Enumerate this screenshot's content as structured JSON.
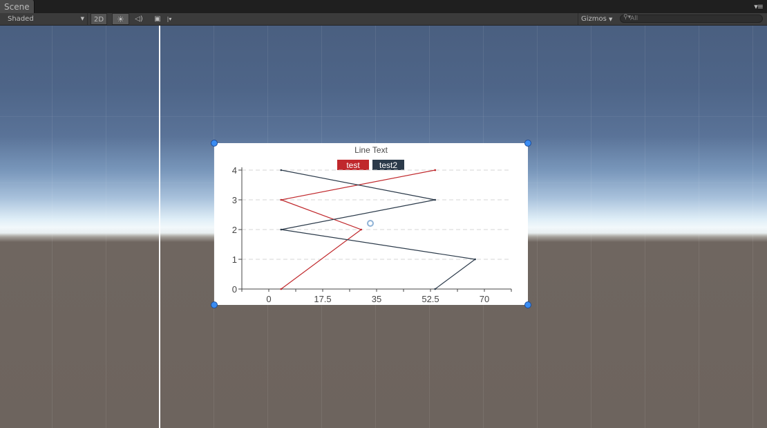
{
  "window": {
    "tab_label": "Scene",
    "menu_icon": "list-menu-icon"
  },
  "toolbar": {
    "shading_mode": "Shaded",
    "mode_2d_label": "2D",
    "lighting_icon": "sun-icon",
    "audio_icon": "speaker-icon",
    "effects_icon": "image-icon",
    "gizmos_label": "Gizmos",
    "search_placeholder": "All"
  },
  "colors": {
    "series1": "#c0282c",
    "series2": "#2b3a4a",
    "handle": "#3a8cf2"
  },
  "chart_data": {
    "type": "line",
    "title": "Line Text",
    "x_ticks": [
      "0",
      "17.5",
      "35",
      "52.5",
      "70"
    ],
    "y_ticks": [
      "0",
      "1",
      "2",
      "3",
      "4"
    ],
    "xlim": [
      -8.75,
      78.75
    ],
    "ylim": [
      0,
      4
    ],
    "legend_position": "top-center",
    "series": [
      {
        "name": "test",
        "x": [
          4,
          30,
          4,
          54,
          54
        ],
        "y": [
          0,
          2,
          3,
          4,
          4
        ]
      },
      {
        "name": "test2",
        "x": [
          54,
          67,
          4,
          54,
          4
        ],
        "y": [
          0,
          1,
          2,
          3,
          4
        ]
      }
    ]
  }
}
